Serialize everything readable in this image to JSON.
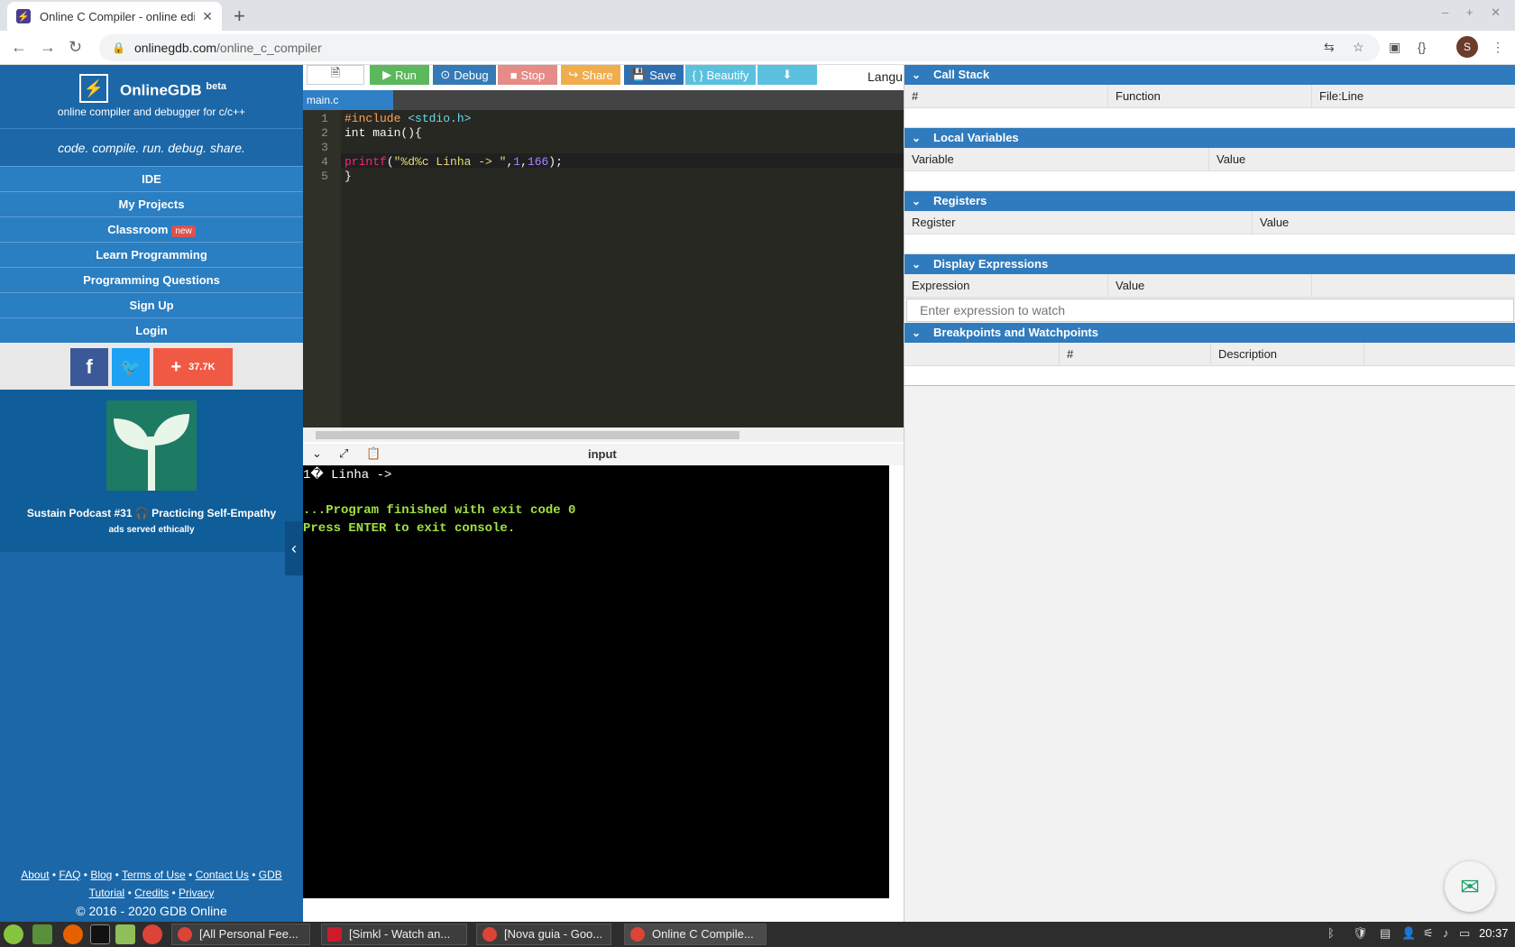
{
  "browser": {
    "tab_title": "Online C Compiler - online edi",
    "url_host": "onlinegdb.com",
    "url_path": "/online_c_compiler",
    "avatar_letter": "S"
  },
  "sidebar": {
    "brand": "OnlineGDB",
    "brand_sup": "beta",
    "subtitle": "online compiler and debugger for c/c++",
    "tagline": "code. compile. run. debug. share.",
    "nav": [
      {
        "label": "IDE"
      },
      {
        "label": "My Projects"
      },
      {
        "label": "Classroom",
        "badge": "new"
      },
      {
        "label": "Learn Programming"
      },
      {
        "label": "Programming Questions"
      },
      {
        "label": "Sign Up"
      },
      {
        "label": "Login"
      }
    ],
    "share_count": "37.7K",
    "ad_title": "Sustain Podcast #31 🎧 Practicing Self-Empathy",
    "ad_sub": "ads served ethically",
    "footer_links": [
      "About",
      "FAQ",
      "Blog",
      "Terms of Use",
      "Contact Us",
      "GDB",
      "Tutorial",
      "Credits",
      "Privacy"
    ],
    "copyright": "© 2016 - 2020 GDB Online"
  },
  "editor": {
    "toolbar": {
      "run": "Run",
      "debug": "Debug",
      "stop": "Stop",
      "share": "Share",
      "save": "Save",
      "beautify": "{ } Beautify",
      "language": "Langu"
    },
    "file_tab": "main.c",
    "line_numbers": [
      "1",
      "2",
      "3",
      "4",
      "5"
    ],
    "code_line1_directive": "#include",
    "code_line1_header": " <stdio.h>",
    "code_line2": "int main(){",
    "code_line4_fn": "printf",
    "code_line4_open": "(",
    "code_line4_str": "\"%d%c Linha -> \"",
    "code_line4_comma1": ",",
    "code_line4_arg1": "1",
    "code_line4_comma2": ",",
    "code_line4_arg2": "166",
    "code_line4_close": ");",
    "code_line5": "}"
  },
  "console": {
    "label": "input",
    "lines": [
      "1� Linha ->",
      "",
      "...Program finished with exit code 0",
      "Press ENTER to exit console."
    ]
  },
  "debug": {
    "call_stack": {
      "title": "Call Stack",
      "cols": [
        "#",
        "Function",
        "File:Line"
      ]
    },
    "locals": {
      "title": "Local Variables",
      "cols": [
        "Variable",
        "Value"
      ]
    },
    "registers": {
      "title": "Registers",
      "cols": [
        "Register",
        "Value"
      ]
    },
    "display": {
      "title": "Display Expressions",
      "cols": [
        "Expression",
        "Value"
      ],
      "placeholder": "Enter expression to watch"
    },
    "breakpoints": {
      "title": "Breakpoints and Watchpoints",
      "cols": [
        "#",
        "Description"
      ]
    }
  },
  "taskbar": {
    "windows": [
      "[All Personal Fee...",
      "[Simkl - Watch an...",
      "[Nova guia - Goo...",
      "Online C Compile..."
    ],
    "clock": "20:37"
  },
  "colors": {
    "sidebar": "#1b67a8",
    "run": "#5cb85c",
    "debug": "#337ab7",
    "stop": "#d9534f",
    "share": "#f0ad4e",
    "save": "#2f6fb0",
    "beautify": "#5bc0de"
  }
}
